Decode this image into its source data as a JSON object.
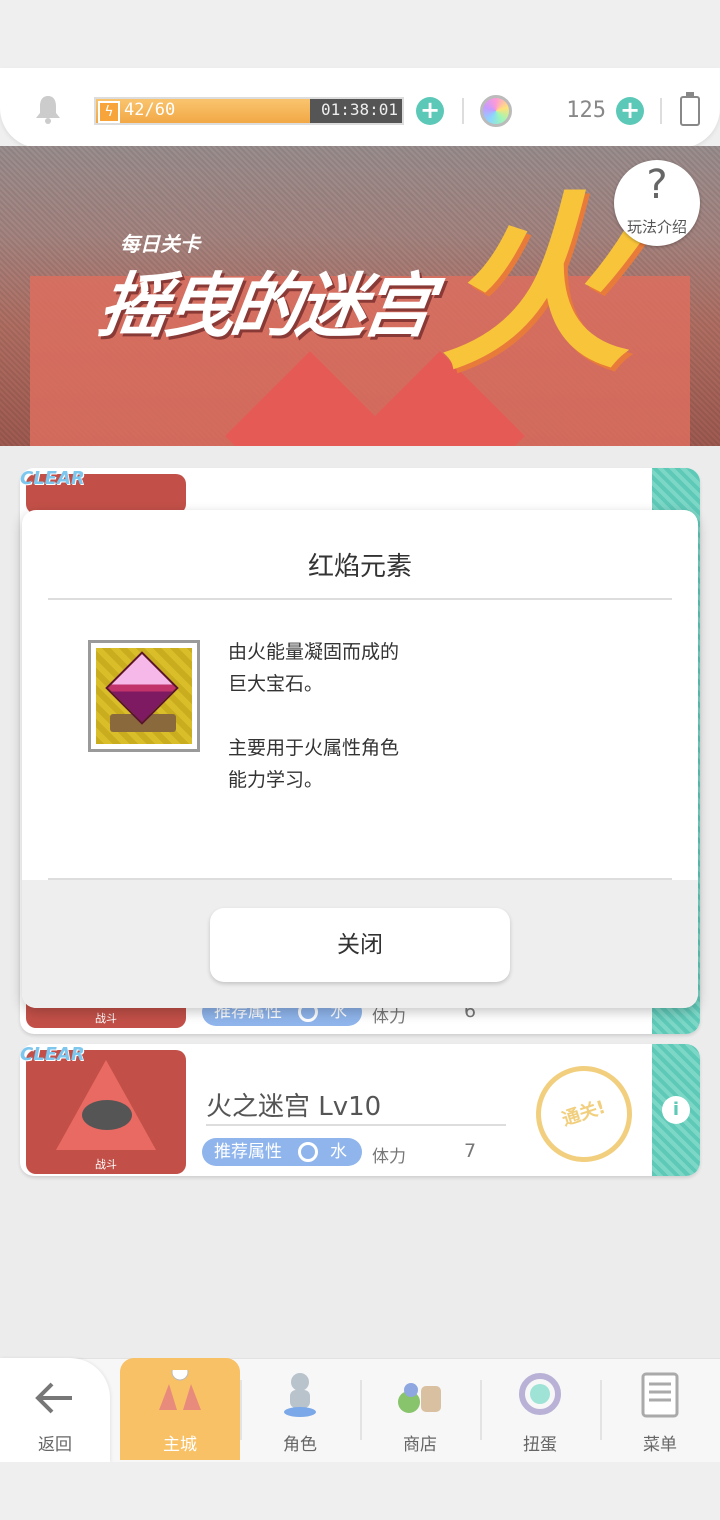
{
  "topbar": {
    "stamina_text": "42/60",
    "stamina_fraction": 0.7,
    "timer": "01:38:01",
    "gem_count": "125"
  },
  "banner": {
    "subtitle": "每日关卡",
    "title": "摇曳的迷宫",
    "element_char": "火",
    "help_label": "玩法介绍"
  },
  "levels": [
    {
      "clear": "CLEAR",
      "thumb_label": "战斗",
      "rec_label": "推荐属性",
      "rec_element": "水",
      "stamina_label": "体力",
      "stamina_cost": "6"
    },
    {
      "clear": "CLEAR",
      "thumb_label": "战斗",
      "name": "火之迷宫 Lv10",
      "rec_label": "推荐属性",
      "rec_element": "水",
      "stamina_label": "体力",
      "stamina_cost": "7",
      "seal": "通关!"
    }
  ],
  "dialog": {
    "title": "红焰元素",
    "desc_lines": [
      "由火能量凝固而成的",
      "巨大宝石。",
      "主要用于火属性角色",
      "能力学习。"
    ],
    "close_label": "关闭"
  },
  "nav": {
    "back": "返回",
    "items": [
      "主城",
      "角色",
      "商店",
      "扭蛋",
      "菜单"
    ]
  },
  "colors": {
    "accent": "#5cc9b8",
    "stamina": "#f2a846",
    "nav_active": "#f9c165",
    "rec_pill": "#8fb5ec"
  },
  "icons": [
    "bell-icon",
    "bolt-icon",
    "plus-icon",
    "rainbow-gem-icon",
    "battery-icon",
    "help-icon",
    "info-icon",
    "back-arrow-icon",
    "castle-icon",
    "character-icon",
    "shop-icon",
    "gacha-icon",
    "menu-icon",
    "ruby-gem-icon"
  ]
}
